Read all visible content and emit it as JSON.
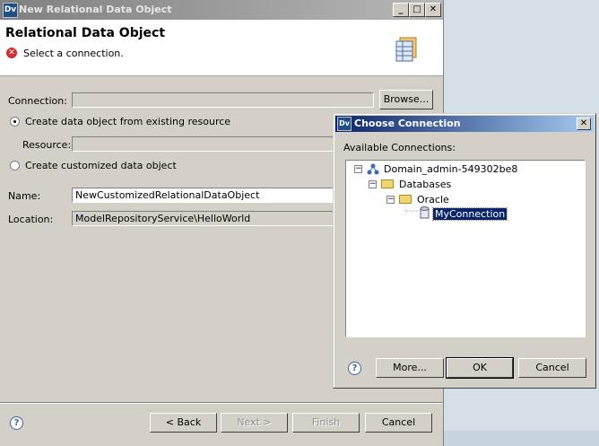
{
  "main_window": {
    "title": "New Relational Data Object",
    "header_title": "Relational Data Object",
    "error_message": "Select a connection.",
    "connection_label": "Connection:",
    "connection_value": "",
    "browse_label": "Browse...",
    "radio_existing_label": "Create data object from existing resource",
    "resource_label": "Resource:",
    "resource_value": "",
    "radio_custom_label": "Create customized data object",
    "name_label": "Name:",
    "name_value": "NewCustomizedRelationalDataObject",
    "location_label": "Location:",
    "location_value": "ModelRepositoryService\\HelloWorld",
    "buttons": {
      "back": "< Back",
      "next": "Next >",
      "finish": "Finish",
      "cancel": "Cancel"
    },
    "title_controls": {
      "minimize": "_",
      "maximize": "□",
      "close": "✕"
    }
  },
  "choose_connection": {
    "title": "Choose Connection",
    "available_label": "Available Connections:",
    "tree": {
      "domain": "Domain_admin-549302be8",
      "databases": "Databases",
      "oracle": "Oracle",
      "connection": "MyConnection"
    },
    "buttons": {
      "more": "More...",
      "ok": "OK",
      "cancel": "Cancel"
    },
    "close": "✕"
  },
  "app_icon_text": "Dv",
  "help_symbol": "?",
  "icons": [
    "error-icon",
    "help-icon",
    "folder-icon",
    "database-icon",
    "network-icon",
    "banner-table-icon"
  ],
  "colors": {
    "dialog_bg": "#d4d0c8",
    "title_active": "#0a246a",
    "title_inactive": "#808080",
    "selection": "#0a246a"
  }
}
